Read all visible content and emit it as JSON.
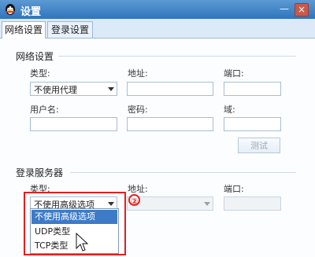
{
  "window": {
    "title": "设置"
  },
  "tabs": [
    {
      "label": "网络设置",
      "active": true
    },
    {
      "label": "登录设置",
      "active": false
    }
  ],
  "network_section": {
    "title": "网络设置",
    "type_label": "类型:",
    "type_value": "不使用代理",
    "address_label": "地址:",
    "address_value": "",
    "port_label": "端口:",
    "port_value": "",
    "username_label": "用户名:",
    "username_value": "",
    "password_label": "密码:",
    "password_value": "",
    "domain_label": "域:",
    "domain_value": "",
    "test_button": "测试"
  },
  "login_server_section": {
    "title": "登录服务器",
    "type_label": "类型:",
    "type_value": "不使用高级选项",
    "address_label": "地址:",
    "address_value": "",
    "port_label": "端口:",
    "port_value": "",
    "type_options": [
      "不使用高级选项",
      "UDP类型",
      "TCP类型"
    ],
    "selected_option": "不使用高级选项"
  },
  "annotation": {
    "marker": "②"
  },
  "colors": {
    "accent": "#3d7bc8",
    "annotation": "#e02020",
    "titlebar": "#2f74bd"
  },
  "icons": {
    "app": "qq-penguin-icon",
    "minimize": "minimize-icon",
    "close": "close-icon",
    "dropdown": "chevron-down-icon",
    "cursor": "mouse-pointer-icon"
  }
}
